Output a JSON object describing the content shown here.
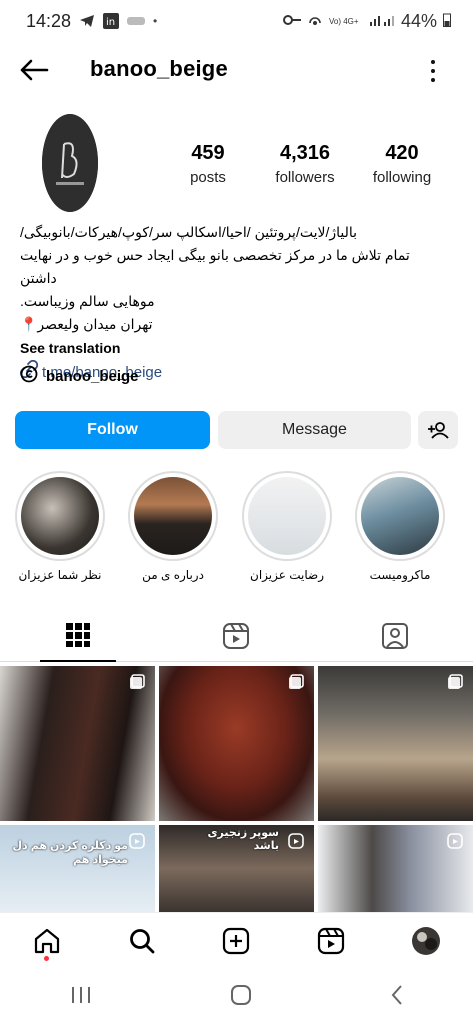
{
  "status": {
    "time": "14:28",
    "battery": "44%",
    "net_label": "Vo) 4G+"
  },
  "header": {
    "username": "banoo_beige"
  },
  "stats": [
    {
      "value": "459",
      "label": "posts"
    },
    {
      "value": "4,316",
      "label": "followers"
    },
    {
      "value": "420",
      "label": "following"
    }
  ],
  "bio": {
    "line1": "بالیاژ/لایت/پروتئین /احیا/اسکالپ سر/کوپ/هیرکات/بانوبیگی/",
    "line2": "تمام تلاش ما در مرکز تخصصی بانو بیگی ایجاد حس خوب و در نهایت داشتن",
    "line3": "موهایی سالم وزیباست.",
    "line4": "تهران میدان ولیعصر📍",
    "see_translation": "See translation",
    "link": "t.me/banoo_beige"
  },
  "threads": {
    "handle": "banoo_beige"
  },
  "actions": {
    "follow": "Follow",
    "message": "Message"
  },
  "highlights": [
    {
      "label": "نظر شما عزیزان"
    },
    {
      "label": "درباره ی من"
    },
    {
      "label": "رضایت عزیزان"
    },
    {
      "label": "ماکرومیست"
    }
  ],
  "posts": [
    {
      "overlay": ""
    },
    {
      "overlay": ""
    },
    {
      "overlay": ""
    },
    {
      "overlay": "مو دکلره کردن هم دل میخواد هم"
    },
    {
      "overlay": "سوپر زنجیری باشد"
    },
    {
      "overlay": ""
    }
  ],
  "colors": {
    "accent": "#0095f6",
    "link": "#2b4c7e"
  }
}
